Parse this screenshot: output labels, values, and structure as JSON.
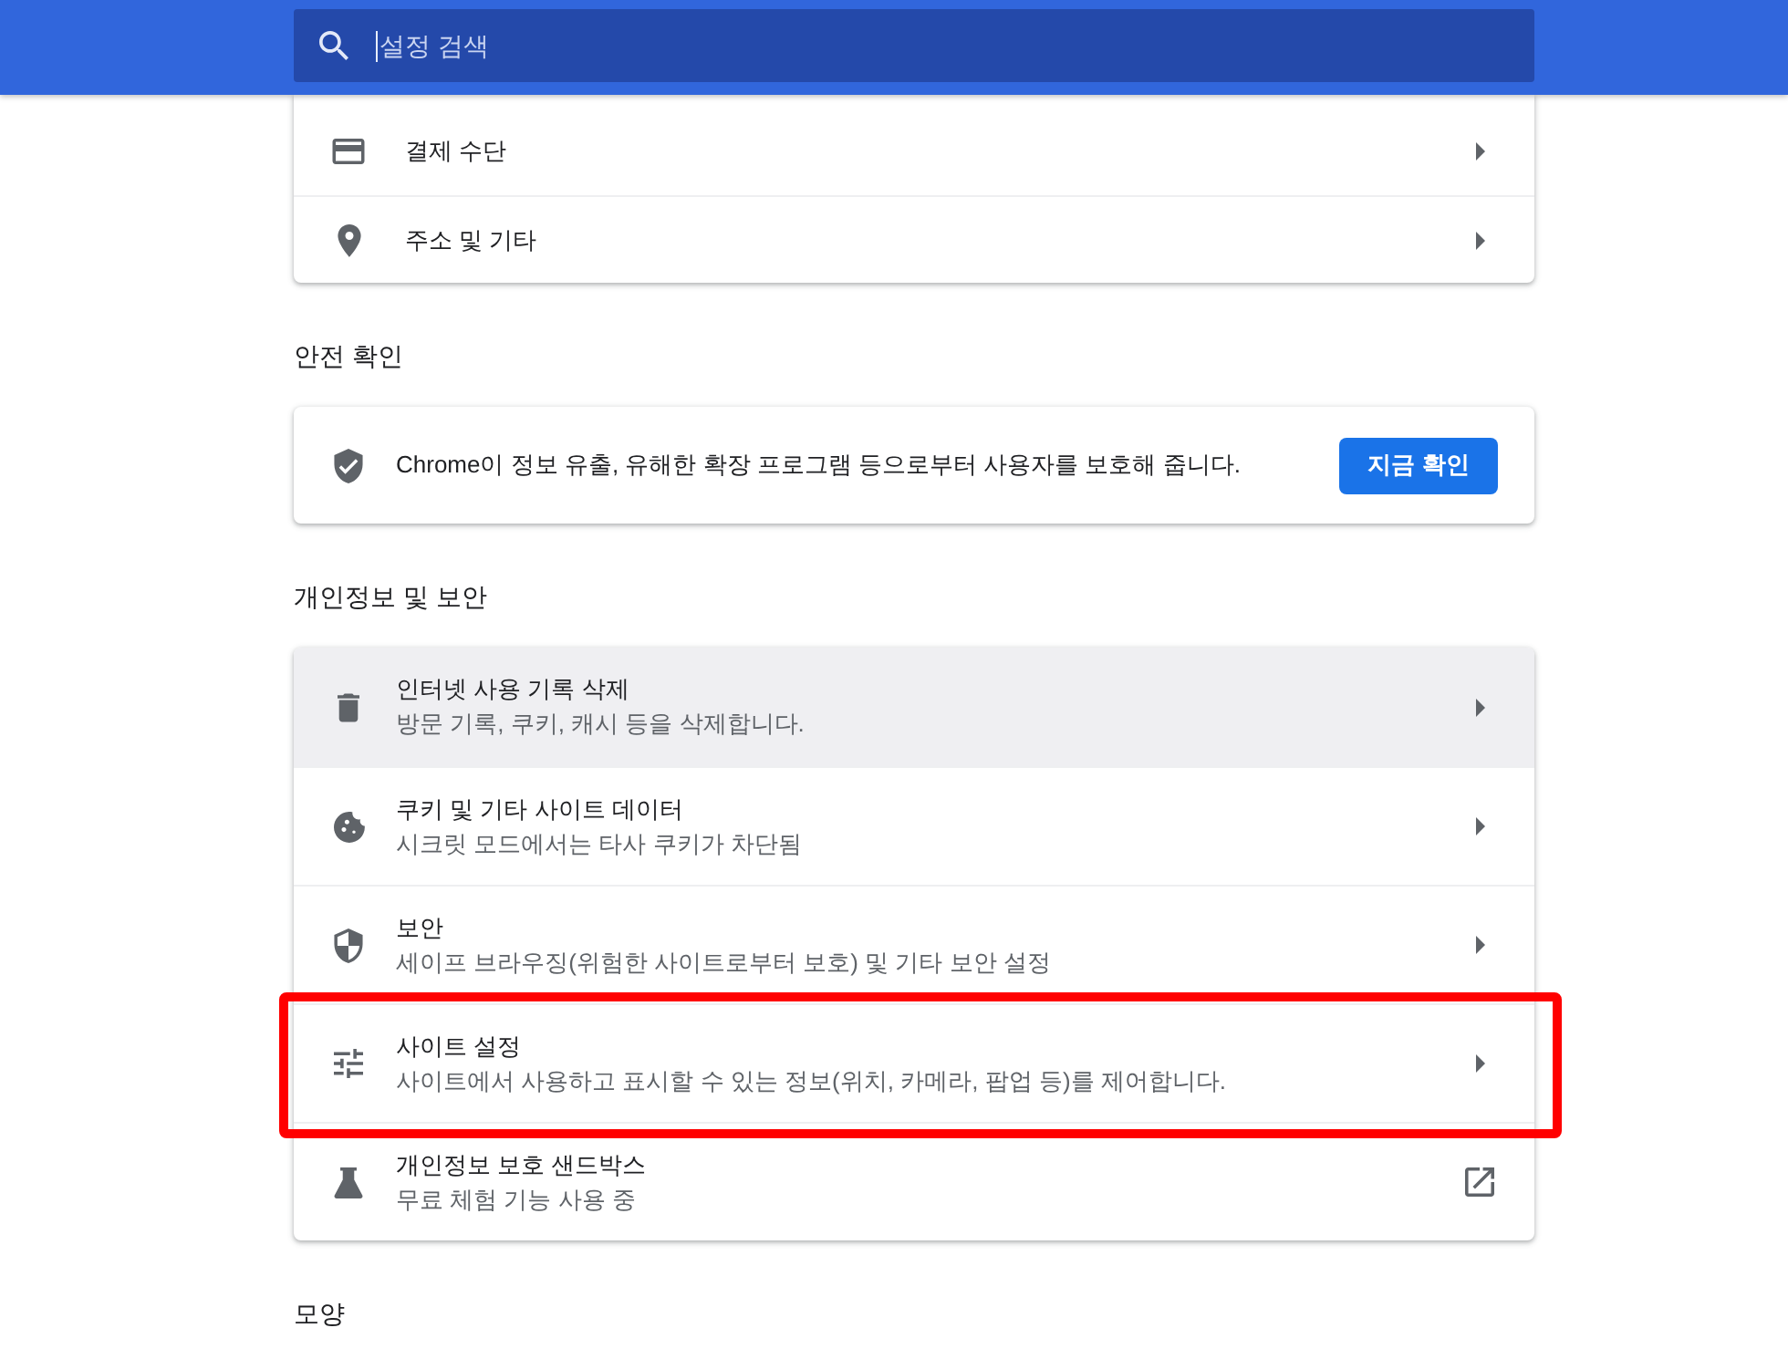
{
  "search_bar": {
    "placeholder": "설정 검색",
    "focused": true
  },
  "top_card": {
    "rows": [
      {
        "label": "결제 수단",
        "kind": "submenu"
      },
      {
        "label": "주소 및 기타",
        "kind": "submenu"
      }
    ]
  },
  "safety_check": {
    "heading": "안전 확인",
    "text": "Chrome이 정보 유출, 유해한 확장 프로그램 등으로부터 사용자를 보호해 줍니다.",
    "button": "지금 확인"
  },
  "privacy": {
    "heading": "개인정보 및 보안",
    "rows": [
      {
        "label": "인터넷 사용 기록 삭제",
        "description": "방문 기록, 쿠키, 캐시 등을 삭제합니다.",
        "kind": "submenu",
        "hovered": true,
        "highlighted": false
      },
      {
        "label": "쿠키 및 기타 사이트 데이터",
        "description": "시크릿 모드에서는 타사 쿠키가 차단됨",
        "kind": "submenu",
        "hovered": false,
        "highlighted": false
      },
      {
        "label": "보안",
        "description": "세이프 브라우징(위험한 사이트로부터 보호) 및 기타 보안 설정",
        "kind": "submenu",
        "hovered": false,
        "highlighted": false
      },
      {
        "label": "사이트 설정",
        "description": "사이트에서 사용하고 표시할 수 있는 정보(위치, 카메라, 팝업 등)를 제어합니다.",
        "kind": "submenu",
        "hovered": false,
        "highlighted": true
      },
      {
        "label": "개인정보 보호 샌드박스",
        "description": "무료 체험 기능 사용 중",
        "kind": "external",
        "hovered": false,
        "highlighted": false
      }
    ]
  },
  "appearance": {
    "heading": "모양"
  }
}
